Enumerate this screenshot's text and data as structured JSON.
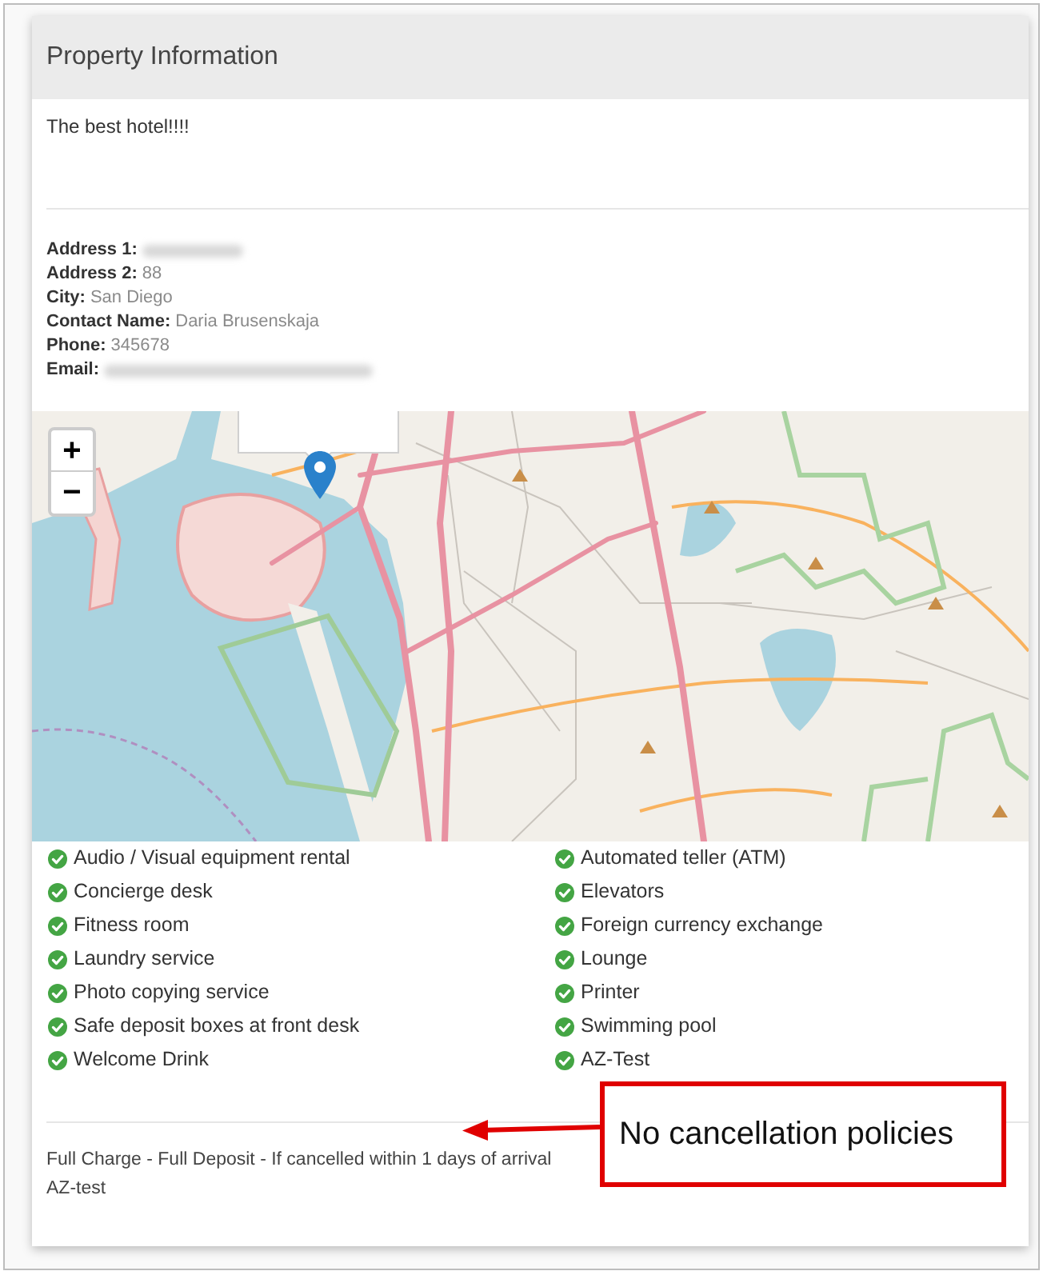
{
  "panel": {
    "title": "Property Information",
    "description": "The best hotel!!!!"
  },
  "address": [
    {
      "label": "Address 1:",
      "blurred": true
    },
    {
      "label": "Address 2:",
      "value": "88",
      "blurred": false
    },
    {
      "label": "City:",
      "value": "San Diego",
      "blurred": false
    },
    {
      "label": "Contact Name:",
      "value": "Daria Brusenskaja",
      "blurred": false
    },
    {
      "label": "Phone:",
      "value": "345678",
      "blurred": false
    },
    {
      "label": "Email:",
      "blurred": true
    }
  ],
  "map": {
    "zoom_in": "+",
    "zoom_out": "−"
  },
  "amenities": [
    "Audio / Visual equipment rental",
    "Automated teller (ATM)",
    "Concierge desk",
    "Elevators",
    "Fitness room",
    "Foreign currency exchange",
    "Laundry service",
    "Lounge",
    "Photo copying service",
    "Printer",
    "Safe deposit boxes at front desk",
    "Swimming pool",
    "Welcome Drink",
    "AZ-Test"
  ],
  "cancellation_policies": [
    "Full Charge - Full Deposit - If cancelled within 1 days of arrival",
    "AZ-test"
  ],
  "annotation": {
    "text": "No cancellation policies"
  }
}
